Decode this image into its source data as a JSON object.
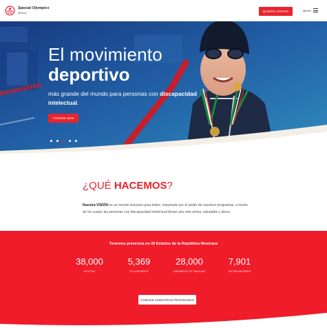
{
  "header": {
    "logo_brand": "Special Olympics",
    "logo_country": "México",
    "donate_label": "QUIERO DONAR",
    "menu_label": "MENÚ"
  },
  "hero": {
    "title_line1": "El movimiento",
    "title_line2": "deportivo",
    "subtitle_part1": "más grande del mundo para personas con ",
    "subtitle_bold1": "discapacidad",
    "subtitle_bold2": "intelectual",
    "subtitle_end": ".",
    "button_label": "CONOCE MÁS",
    "slides": 5,
    "active_slide": 3
  },
  "what": {
    "heading_open": "¿QUÉ ",
    "heading_bold": "HACEMOS",
    "heading_close": "?",
    "vision_label": "Nuestra VISIÓN",
    "vision_text": " es un mundo inclusivo para todos, impulsado por el poder de nuestros programas, a través de los cuales las personas con discapacidad intelectual llevan una vida activa, saludable y plena."
  },
  "stats": {
    "title": "Tenemos presencia en 28 Estados de la República Mexicana",
    "items": [
      {
        "value": "38,000",
        "label": "ATLETAS"
      },
      {
        "value": "5,369",
        "label": "VOLUNTARIOS"
      },
      {
        "value": "28,000",
        "label": "MIEMBROS DE FAMILIAS"
      },
      {
        "value": "7,901",
        "label": "ENTRENADORES"
      }
    ],
    "button_label": "CONOCE NUESTROS PROGRAMAS"
  },
  "colors": {
    "brand_red": "#e8242c",
    "stats_red": "#f01c2a",
    "hero_blue": "#1f4f9a"
  }
}
